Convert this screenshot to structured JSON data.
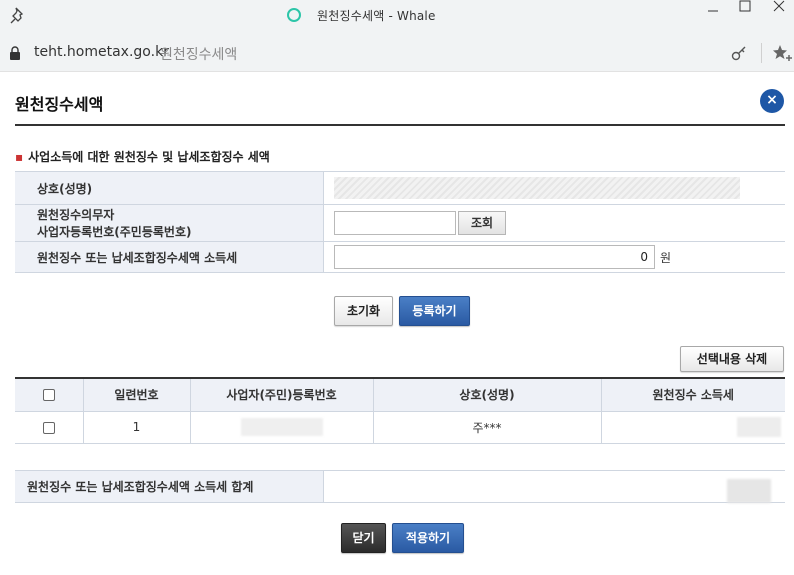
{
  "window": {
    "title": "원천징수세액 - Whale",
    "url_host": "teht.hometax.go.kr",
    "url_title": "원천징수세액"
  },
  "page": {
    "title": "원천징수세액",
    "close_symbol": "×"
  },
  "form": {
    "section_title": "사업소득에 대한 원천징수 및 납세조합징수 세액",
    "labels": {
      "company": "상호(성명)",
      "withholder_line1": "원천징수의무자",
      "withholder_line2": "사업자등록번호(주민등록번호)",
      "amount": "원천징수 또는 납세조합징수세액 소득세"
    },
    "business_number_value": "",
    "lookup_label": "조회",
    "amount_value": "0",
    "amount_unit": "원"
  },
  "actions": {
    "reset_label": "초기화",
    "register_label": "등록하기",
    "delete_selected_label": "선택내용 삭제",
    "close_label": "닫기",
    "apply_label": "적용하기"
  },
  "grid": {
    "headers": [
      "일련번호",
      "사업자(주민)등록번호",
      "상호(성명)",
      "원천징수 소득세"
    ],
    "rows": [
      {
        "seq": "1",
        "reg_no": "",
        "company": "주***",
        "tax": ""
      }
    ]
  },
  "total": {
    "label": "원천징수 또는 납세조합징수세액 소득세 합계"
  },
  "colors": {
    "accent_blue": "#2a5aa3",
    "header_bg": "#eef1f7",
    "close_circle": "#1e57a6"
  }
}
